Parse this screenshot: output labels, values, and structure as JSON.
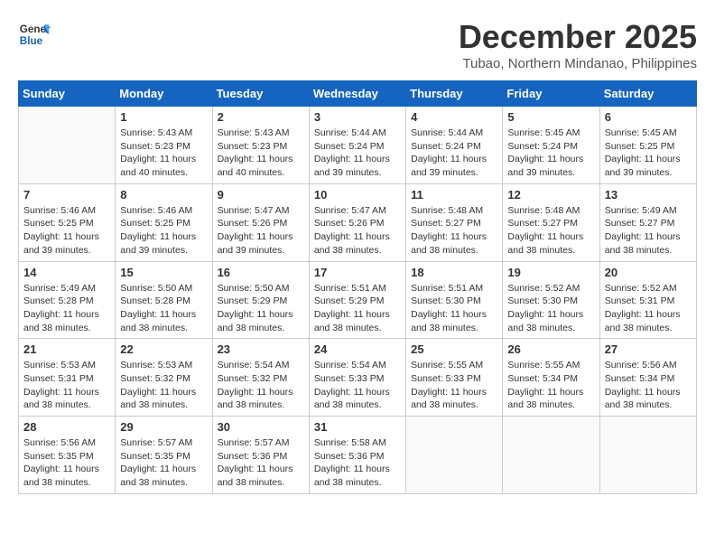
{
  "header": {
    "logo_general": "General",
    "logo_blue": "Blue",
    "month_title": "December 2025",
    "location": "Tubao, Northern Mindanao, Philippines"
  },
  "weekdays": [
    "Sunday",
    "Monday",
    "Tuesday",
    "Wednesday",
    "Thursday",
    "Friday",
    "Saturday"
  ],
  "weeks": [
    [
      {
        "day": null
      },
      {
        "day": 1,
        "sunrise": "5:43 AM",
        "sunset": "5:23 PM",
        "daylight": "11 hours and 40 minutes."
      },
      {
        "day": 2,
        "sunrise": "5:43 AM",
        "sunset": "5:23 PM",
        "daylight": "11 hours and 40 minutes."
      },
      {
        "day": 3,
        "sunrise": "5:44 AM",
        "sunset": "5:24 PM",
        "daylight": "11 hours and 39 minutes."
      },
      {
        "day": 4,
        "sunrise": "5:44 AM",
        "sunset": "5:24 PM",
        "daylight": "11 hours and 39 minutes."
      },
      {
        "day": 5,
        "sunrise": "5:45 AM",
        "sunset": "5:24 PM",
        "daylight": "11 hours and 39 minutes."
      },
      {
        "day": 6,
        "sunrise": "5:45 AM",
        "sunset": "5:25 PM",
        "daylight": "11 hours and 39 minutes."
      }
    ],
    [
      {
        "day": 7,
        "sunrise": "5:46 AM",
        "sunset": "5:25 PM",
        "daylight": "11 hours and 39 minutes."
      },
      {
        "day": 8,
        "sunrise": "5:46 AM",
        "sunset": "5:25 PM",
        "daylight": "11 hours and 39 minutes."
      },
      {
        "day": 9,
        "sunrise": "5:47 AM",
        "sunset": "5:26 PM",
        "daylight": "11 hours and 39 minutes."
      },
      {
        "day": 10,
        "sunrise": "5:47 AM",
        "sunset": "5:26 PM",
        "daylight": "11 hours and 38 minutes."
      },
      {
        "day": 11,
        "sunrise": "5:48 AM",
        "sunset": "5:27 PM",
        "daylight": "11 hours and 38 minutes."
      },
      {
        "day": 12,
        "sunrise": "5:48 AM",
        "sunset": "5:27 PM",
        "daylight": "11 hours and 38 minutes."
      },
      {
        "day": 13,
        "sunrise": "5:49 AM",
        "sunset": "5:27 PM",
        "daylight": "11 hours and 38 minutes."
      }
    ],
    [
      {
        "day": 14,
        "sunrise": "5:49 AM",
        "sunset": "5:28 PM",
        "daylight": "11 hours and 38 minutes."
      },
      {
        "day": 15,
        "sunrise": "5:50 AM",
        "sunset": "5:28 PM",
        "daylight": "11 hours and 38 minutes."
      },
      {
        "day": 16,
        "sunrise": "5:50 AM",
        "sunset": "5:29 PM",
        "daylight": "11 hours and 38 minutes."
      },
      {
        "day": 17,
        "sunrise": "5:51 AM",
        "sunset": "5:29 PM",
        "daylight": "11 hours and 38 minutes."
      },
      {
        "day": 18,
        "sunrise": "5:51 AM",
        "sunset": "5:30 PM",
        "daylight": "11 hours and 38 minutes."
      },
      {
        "day": 19,
        "sunrise": "5:52 AM",
        "sunset": "5:30 PM",
        "daylight": "11 hours and 38 minutes."
      },
      {
        "day": 20,
        "sunrise": "5:52 AM",
        "sunset": "5:31 PM",
        "daylight": "11 hours and 38 minutes."
      }
    ],
    [
      {
        "day": 21,
        "sunrise": "5:53 AM",
        "sunset": "5:31 PM",
        "daylight": "11 hours and 38 minutes."
      },
      {
        "day": 22,
        "sunrise": "5:53 AM",
        "sunset": "5:32 PM",
        "daylight": "11 hours and 38 minutes."
      },
      {
        "day": 23,
        "sunrise": "5:54 AM",
        "sunset": "5:32 PM",
        "daylight": "11 hours and 38 minutes."
      },
      {
        "day": 24,
        "sunrise": "5:54 AM",
        "sunset": "5:33 PM",
        "daylight": "11 hours and 38 minutes."
      },
      {
        "day": 25,
        "sunrise": "5:55 AM",
        "sunset": "5:33 PM",
        "daylight": "11 hours and 38 minutes."
      },
      {
        "day": 26,
        "sunrise": "5:55 AM",
        "sunset": "5:34 PM",
        "daylight": "11 hours and 38 minutes."
      },
      {
        "day": 27,
        "sunrise": "5:56 AM",
        "sunset": "5:34 PM",
        "daylight": "11 hours and 38 minutes."
      }
    ],
    [
      {
        "day": 28,
        "sunrise": "5:56 AM",
        "sunset": "5:35 PM",
        "daylight": "11 hours and 38 minutes."
      },
      {
        "day": 29,
        "sunrise": "5:57 AM",
        "sunset": "5:35 PM",
        "daylight": "11 hours and 38 minutes."
      },
      {
        "day": 30,
        "sunrise": "5:57 AM",
        "sunset": "5:36 PM",
        "daylight": "11 hours and 38 minutes."
      },
      {
        "day": 31,
        "sunrise": "5:58 AM",
        "sunset": "5:36 PM",
        "daylight": "11 hours and 38 minutes."
      },
      {
        "day": null
      },
      {
        "day": null
      },
      {
        "day": null
      }
    ]
  ],
  "labels": {
    "sunrise": "Sunrise:",
    "sunset": "Sunset:",
    "daylight": "Daylight:"
  }
}
